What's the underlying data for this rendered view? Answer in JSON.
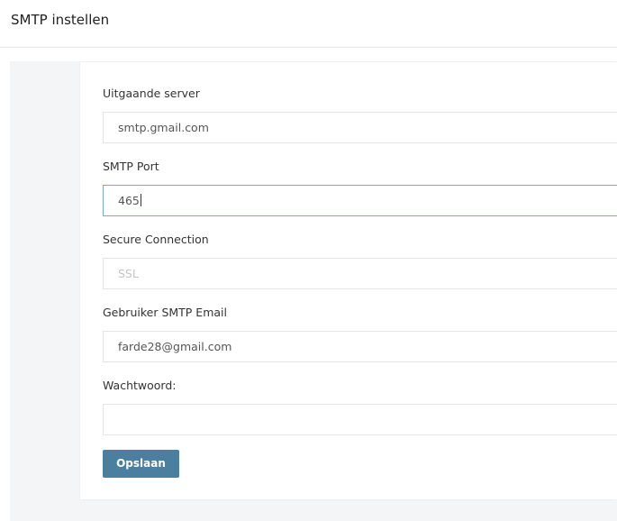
{
  "header": {
    "title": "SMTP instellen"
  },
  "form": {
    "server": {
      "label": "Uitgaande server",
      "value": "smtp.gmail.com"
    },
    "port": {
      "label": "SMTP Port",
      "value": "465"
    },
    "secure": {
      "label": "Secure Connection",
      "placeholder": "SSL"
    },
    "email": {
      "label": "Gebruiker SMTP Email",
      "value": "farde28@gmail.com"
    },
    "password": {
      "label": "Wachtwoord:",
      "value": ""
    },
    "save_label": "Opslaan"
  },
  "colors": {
    "button": "#4a7fa0",
    "focus_border": "#80a6c8",
    "content_background": "#f4f5f7"
  }
}
